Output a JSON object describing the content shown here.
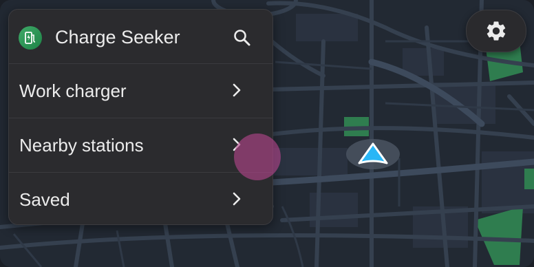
{
  "app": {
    "title": "Charge Seeker",
    "icon": "ev-charger-icon",
    "accent_color": "#2e9a57"
  },
  "header": {
    "search_icon": "search-icon"
  },
  "menu": {
    "items": [
      {
        "label": "Work charger",
        "icon": "chevron-right-icon"
      },
      {
        "label": "Nearby stations",
        "icon": "chevron-right-icon"
      },
      {
        "label": "Saved",
        "icon": "chevron-right-icon"
      }
    ]
  },
  "map_controls": {
    "settings_icon": "gear-icon",
    "location_icon": "navigation-arrow-icon",
    "location_color": "#29b6f6"
  },
  "colors": {
    "map_background": "#222933",
    "road_color": "#35404f",
    "park_color": "#2f7d4f",
    "panel_background": "#2b2b2e",
    "touch_indicator": "#b4468c"
  }
}
